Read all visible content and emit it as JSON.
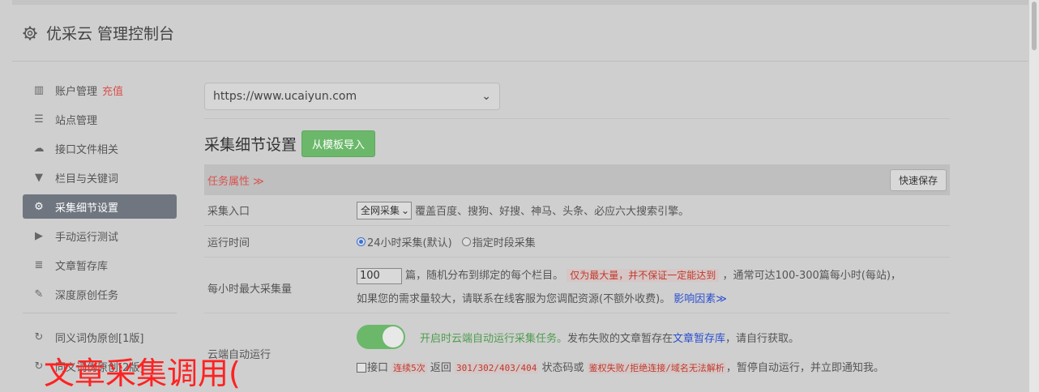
{
  "header": {
    "title": "优采云 管理控制台"
  },
  "sidebar": {
    "items": [
      {
        "icon": "bar-chart-icon",
        "glyph": "▥",
        "label": "账户管理",
        "badge": "充值"
      },
      {
        "icon": "server-icon",
        "glyph": "☰",
        "label": "站点管理"
      },
      {
        "icon": "cloud-upload-icon",
        "glyph": "☁",
        "label": "接口文件相关"
      },
      {
        "icon": "filter-icon",
        "glyph": "▼",
        "label": "栏目与关键词"
      },
      {
        "icon": "gears-icon",
        "glyph": "⚙",
        "label": "采集细节设置"
      },
      {
        "icon": "play-circle-icon",
        "glyph": "▶",
        "label": "手动运行测试"
      },
      {
        "icon": "database-icon",
        "glyph": "≣",
        "label": "文章暂存库"
      },
      {
        "icon": "edit-icon",
        "glyph": "✎",
        "label": "深度原创任务"
      },
      {
        "icon": "refresh-icon",
        "glyph": "↻",
        "label": "同义词伪原创[1版]"
      },
      {
        "icon": "refresh-icon",
        "glyph": "↻",
        "label": "同义词伪原创[2版]"
      }
    ]
  },
  "main": {
    "site_select": "https://www.ucaiyun.com",
    "section_title": "采集细节设置",
    "import_button": "从模板导入",
    "task_attr": "任务属性 ≫",
    "quick_save": "快速保存",
    "rows": {
      "entry": {
        "label": "采集入口",
        "select": "全网采集",
        "desc": "覆盖百度、搜狗、好搜、神马、头条、必应六大搜索引擎。"
      },
      "runtime": {
        "label": "运行时间",
        "opt1": "24小时采集(默认)",
        "opt2": "指定时段采集"
      },
      "max": {
        "label": "每小时最大采集量",
        "value": "100",
        "text1": "篇，随机分布到绑定的每个栏目。",
        "warn": "仅为最大量，并不保证一定能达到",
        "text2": "，通常可达100-300篇每小时(每站)，",
        "text3": "如果您的需求量较大，请联系在线客服为您调配资源(不额外收费)。",
        "link": "影响因素≫"
      },
      "cloud": {
        "label": "云端自动运行",
        "green": "开启时云端自动运行采集任务。",
        "text1": "发布失败的文章暂存在",
        "link": "文章暂存库",
        "text2": "，请自行获取。",
        "chk_label": "接口",
        "code1": "连续5次",
        "text3": " 返回 ",
        "code2": "301/302/403/404",
        "text4": " 状态码或 ",
        "code3": "鉴权失败/拒绝连接/域名无法解析",
        "text5": "，暂停自动运行，并立即通知我。"
      }
    }
  },
  "overlay": "文章采集调用("
}
